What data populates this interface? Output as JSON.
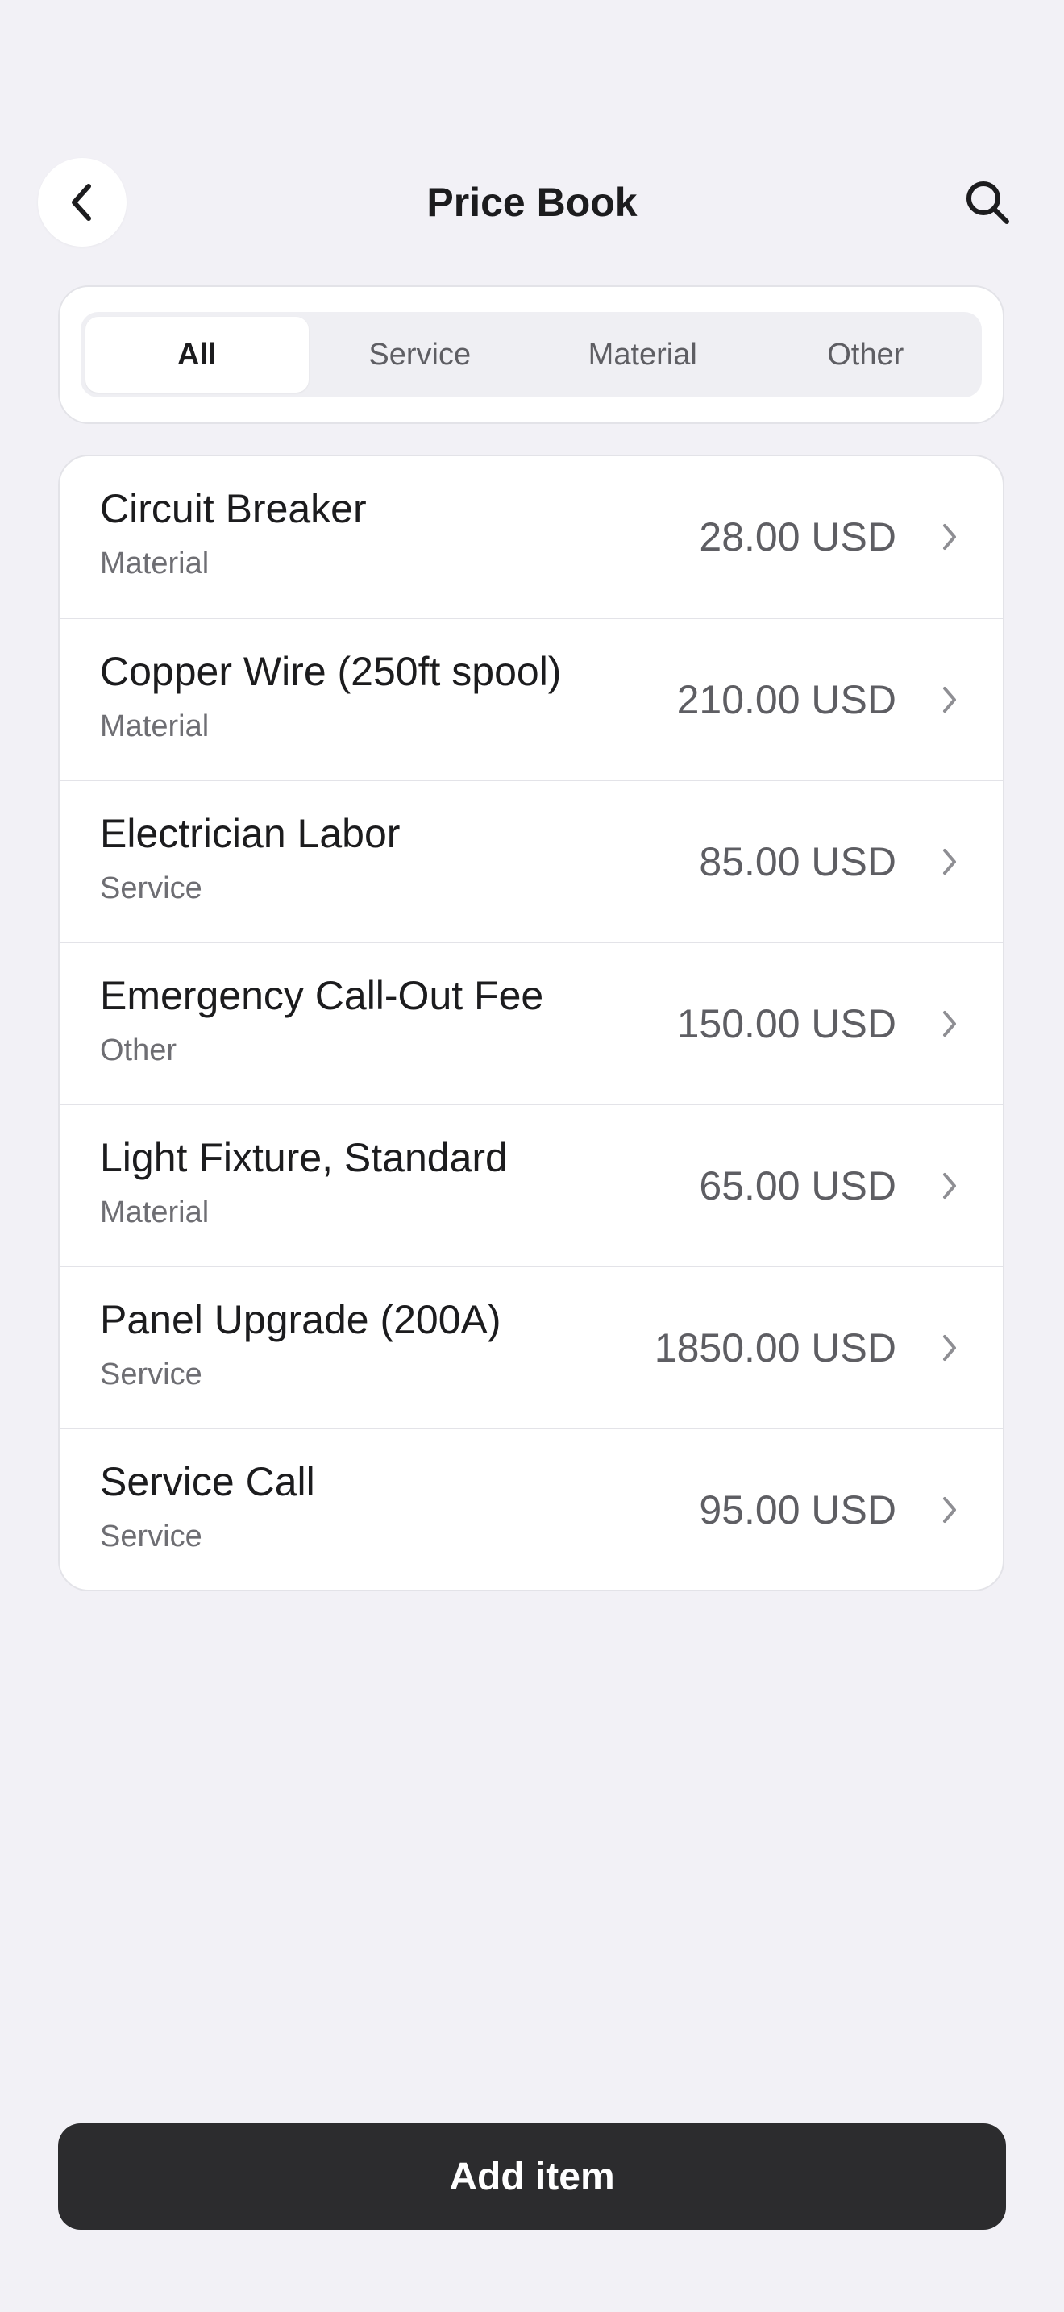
{
  "header": {
    "title": "Price Book",
    "back_icon": "chevron-left-icon",
    "search_icon": "search-icon"
  },
  "filters": {
    "selected": "All",
    "segments": [
      {
        "label": "All"
      },
      {
        "label": "Service"
      },
      {
        "label": "Material"
      },
      {
        "label": "Other"
      }
    ]
  },
  "items": [
    {
      "name": "Circuit Breaker",
      "category": "Material",
      "price": "28.00 USD"
    },
    {
      "name": "Copper Wire (250ft spool)",
      "category": "Material",
      "price": "210.00 USD"
    },
    {
      "name": "Electrician Labor",
      "category": "Service",
      "price": "85.00 USD"
    },
    {
      "name": "Emergency Call-Out Fee",
      "category": "Other",
      "price": "150.00 USD"
    },
    {
      "name": "Light Fixture, Standard",
      "category": "Material",
      "price": "65.00 USD"
    },
    {
      "name": "Panel Upgrade (200A)",
      "category": "Service",
      "price": "1850.00 USD"
    },
    {
      "name": "Service Call",
      "category": "Service",
      "price": "95.00 USD"
    }
  ],
  "footer": {
    "add_label": "Add item"
  },
  "colors": {
    "background": "#f2f1f6",
    "primary_button": "#2c2c2e"
  }
}
